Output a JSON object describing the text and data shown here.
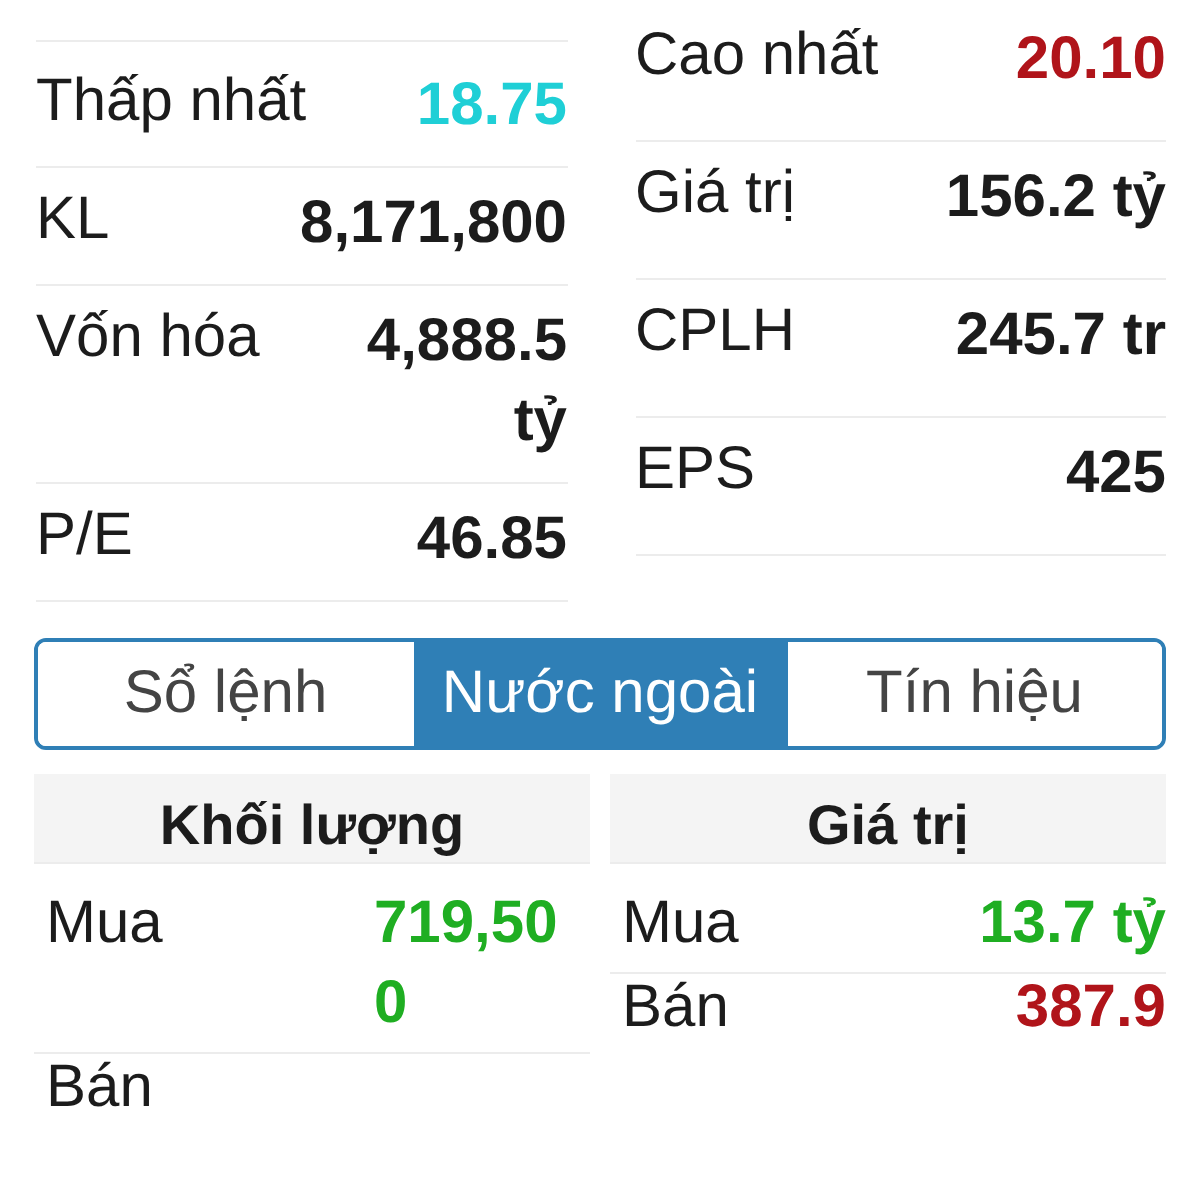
{
  "stats": [
    {
      "items": [
        {
          "label": "Thấp nhất",
          "value": "18.75",
          "color": "#1fcfd6"
        },
        {
          "label": "KL",
          "value": "8,171,800",
          "color": "#1c1c1c"
        },
        {
          "label": "Vốn hóa",
          "value": "4,888.5 tỷ",
          "color": "#1c1c1c"
        },
        {
          "label": "P/E",
          "value": "46.85",
          "color": "#1c1c1c"
        }
      ]
    },
    {
      "items": [
        {
          "label": "Cao nhất",
          "value": "20.10",
          "color": "#b0141a"
        },
        {
          "label": "Giá trị",
          "value": "156.2 tỷ",
          "color": "#1c1c1c"
        },
        {
          "label": "CPLH",
          "value": "245.7 tr",
          "color": "#1c1c1c"
        },
        {
          "label": "EPS",
          "value": "425",
          "color": "#1c1c1c"
        }
      ]
    }
  ],
  "tabs": [
    {
      "label": "Sổ lệnh",
      "selected": false
    },
    {
      "label": "Nước ngoài",
      "selected": true
    },
    {
      "label": "Tín hiệu",
      "selected": false
    }
  ],
  "foreign": [
    {
      "heading": "Khối lượng",
      "rows": [
        {
          "label": "Mua",
          "value": "719,500",
          "color": "#1fae22"
        },
        {
          "label": "Bán"
        }
      ]
    },
    {
      "heading": "Giá trị",
      "rows": [
        {
          "label": "Mua",
          "value": "13.7 tỷ",
          "color": "#1fae22"
        },
        {
          "label": "Bán",
          "value": "387.9",
          "color": "#b0141a"
        }
      ]
    }
  ]
}
